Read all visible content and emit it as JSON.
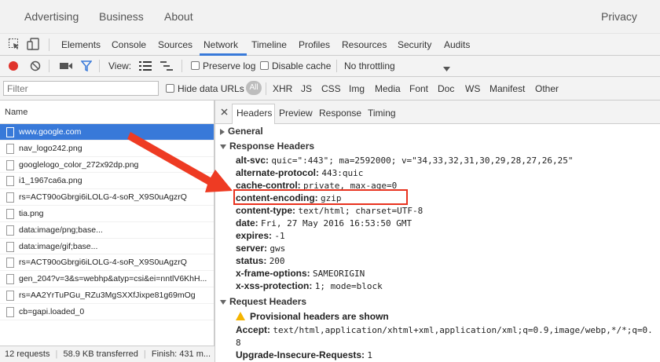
{
  "google_bar": {
    "advertising": "Advertising",
    "business": "Business",
    "about": "About",
    "privacy": "Privacy"
  },
  "devtools_tabs": [
    "Elements",
    "Console",
    "Sources",
    "Network",
    "Timeline",
    "Profiles",
    "Resources",
    "Security",
    "Audits"
  ],
  "devtools_active_tab": "Network",
  "toolbar": {
    "view_label": "View:",
    "preserve_log": "Preserve log",
    "disable_cache": "Disable cache",
    "throttling": "No throttling"
  },
  "filterbar": {
    "filter_placeholder": "Filter",
    "hide_data_urls": "Hide data URLs",
    "all": "All",
    "types": [
      "XHR",
      "JS",
      "CSS",
      "Img",
      "Media",
      "Font",
      "Doc",
      "WS",
      "Manifest",
      "Other"
    ]
  },
  "request_list": {
    "header": "Name",
    "rows": [
      "www.google.com",
      "nav_logo242.png",
      "googlelogo_color_272x92dp.png",
      "i1_1967ca6a.png",
      "rs=ACT90oGbrgi6iLOLG-4-soR_X9S0uAgzrQ",
      "tia.png",
      "data:image/png;base...",
      "data:image/gif;base...",
      "rs=ACT90oGbrgi6iLOLG-4-soR_X9S0uAgzrQ",
      "gen_204?v=3&s=webhp&atyp=csi&ei=nntlV6KhH...",
      "rs=AA2YrTuPGu_RZu3MgSXXfJixpe81g69mOg",
      "cb=gapi.loaded_0"
    ]
  },
  "statusbar": {
    "requests": "12 requests",
    "transferred": "58.9 KB transferred",
    "finish": "Finish: 431 m..."
  },
  "detail_tabs": [
    "Headers",
    "Preview",
    "Response",
    "Timing"
  ],
  "detail_active_tab": "Headers",
  "sections": {
    "general": "General",
    "response_headers": "Response Headers",
    "request_headers": "Request Headers"
  },
  "response_headers": [
    {
      "key": "alt-svc:",
      "value": "quic=\":443\"; ma=2592000; v=\"34,33,32,31,30,29,28,27,26,25\""
    },
    {
      "key": "alternate-protocol:",
      "value": "443:quic"
    },
    {
      "key": "cache-control:",
      "value": "private, max-age=0"
    },
    {
      "key": "content-encoding:",
      "value": "gzip"
    },
    {
      "key": "content-type:",
      "value": "text/html; charset=UTF-8"
    },
    {
      "key": "date:",
      "value": "Fri, 27 May 2016 16:53:50 GMT"
    },
    {
      "key": "expires:",
      "value": "-1"
    },
    {
      "key": "server:",
      "value": "gws"
    },
    {
      "key": "status:",
      "value": "200"
    },
    {
      "key": "x-frame-options:",
      "value": "SAMEORIGIN"
    },
    {
      "key": "x-xss-protection:",
      "value": "1; mode=block"
    }
  ],
  "request_headers": {
    "warning": "Provisional headers are shown",
    "accept_key": "Accept:",
    "accept_value": "text/html,application/xhtml+xml,application/xml;q=0.9,image/webp,*/*;q=0.",
    "accept_value_cont": "8",
    "uir_key": "Upgrade-Insecure-Requests:",
    "uir_value": "1"
  },
  "colors": {
    "accent": "#3879d9",
    "record": "#e0332b",
    "highlight": "#e8321e",
    "arrow": "#ee3b23"
  }
}
